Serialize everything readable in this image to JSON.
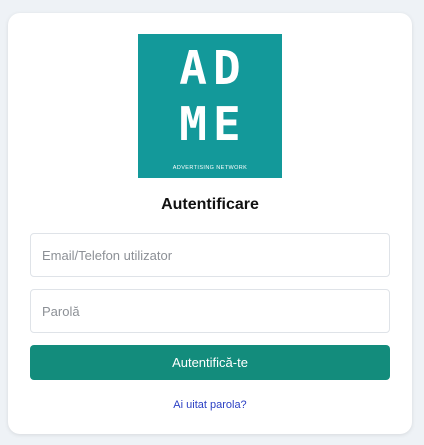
{
  "logo": {
    "letters_line1": "AD",
    "letters_line2": "ME",
    "subtitle": "ADVERTISING NETWORK",
    "background_color": "#13999a"
  },
  "form": {
    "title": "Autentificare",
    "email_placeholder": "Email/Telefon utilizator",
    "password_placeholder": "Parolă",
    "submit_label": "Autentifică-te",
    "forgot_label": "Ai uitat parola?"
  },
  "colors": {
    "accent": "#138c7c",
    "link": "#2a3fc4",
    "page_background": "#eef2f6"
  }
}
